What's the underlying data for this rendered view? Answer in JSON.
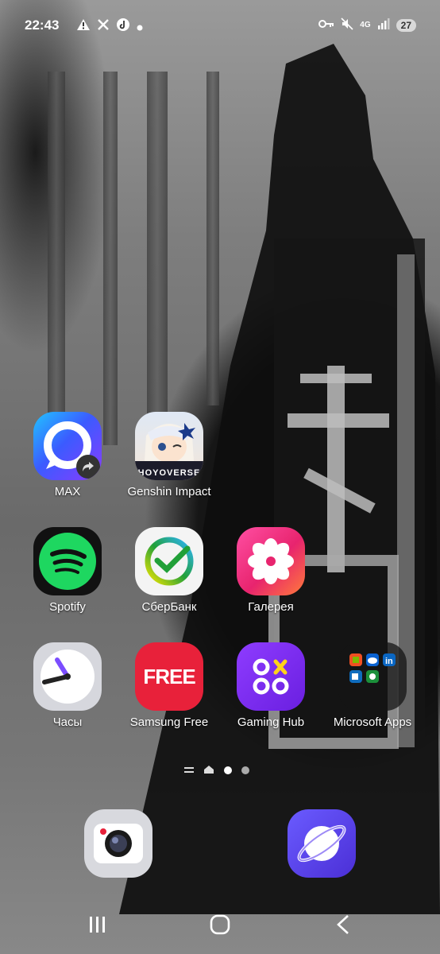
{
  "status_bar": {
    "time": "22:43",
    "left_icons": [
      "warning-icon",
      "x-icon",
      "music-icon",
      "notification-dot-icon"
    ],
    "right_icons": [
      "vpn-key-icon",
      "mute-icon",
      "4g-icon",
      "signal-icon"
    ],
    "network": "4G",
    "battery": "27"
  },
  "home_apps": [
    {
      "label": "MAX",
      "icon": "max-icon"
    },
    {
      "label": "Genshin Impact",
      "icon": "genshin-icon"
    },
    {
      "label": "Spotify",
      "icon": "spotify-icon"
    },
    {
      "label": "СберБанк",
      "icon": "sberbank-icon"
    },
    {
      "label": "Галерея",
      "icon": "gallery-icon"
    },
    {
      "label": "Часы",
      "icon": "clock-icon"
    },
    {
      "label": "Samsung Free",
      "icon": "samsung-free-icon",
      "text": "FREE"
    },
    {
      "label": "Gaming Hub",
      "icon": "gaming-hub-icon"
    },
    {
      "label": "Microsoft Apps",
      "icon": "microsoft-apps-folder-icon"
    }
  ],
  "genshin_banner": "HOYOVERSE",
  "page_indicator": {
    "pages": 4,
    "current": 3
  },
  "dock": [
    {
      "name": "camera",
      "icon": "camera-icon"
    },
    {
      "name": "internet",
      "icon": "internet-icon"
    }
  ],
  "nav_bar": [
    "recents-button",
    "home-button",
    "back-button"
  ],
  "colors": {
    "max": "#3b5bff",
    "spotify_green": "#1ed760",
    "gallery": "#e8246e",
    "samsung_free": "#e8213a",
    "gaming_hub": "#7b2ff7",
    "internet": "#5b3cf0"
  }
}
